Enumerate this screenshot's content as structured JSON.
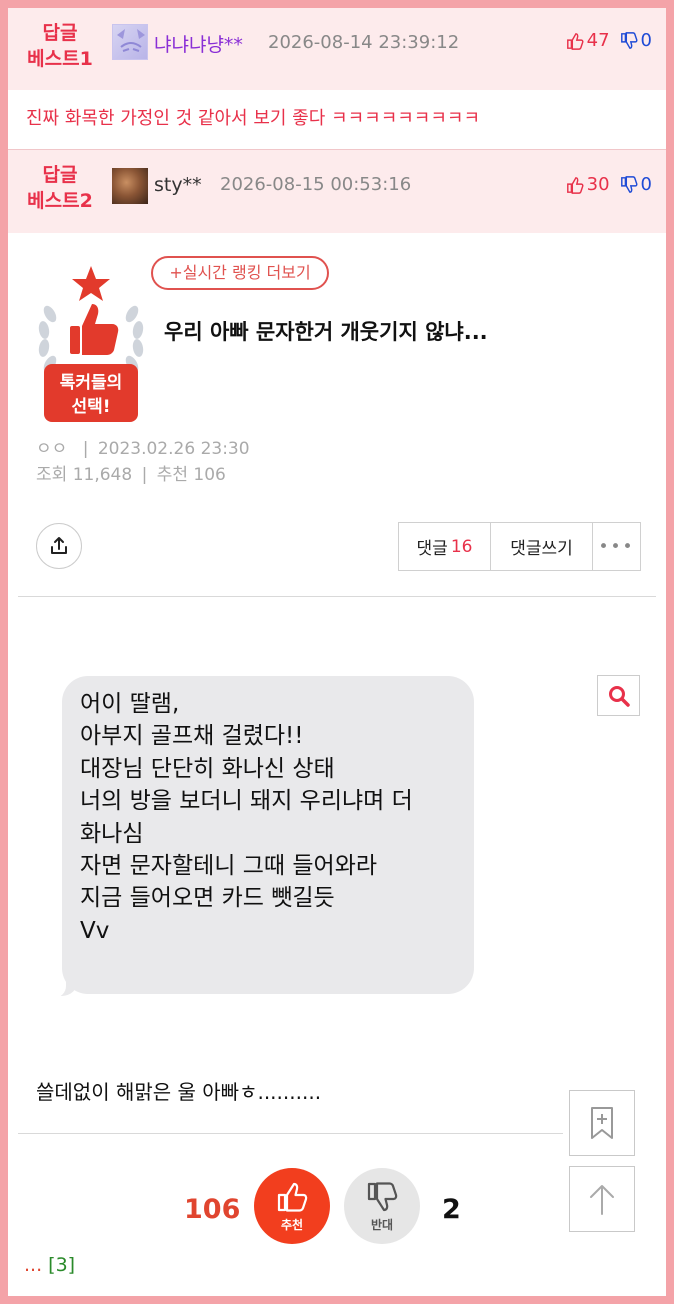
{
  "best_replies": [
    {
      "label_line1": "답글",
      "label_line2": "베스트1",
      "nickname": "냐냐냐냥**",
      "date": "2026-08-14 23:39:12",
      "up": "47",
      "down": "0",
      "text": "진짜 화목한 가정인 것 같아서 보기 좋다 ㅋㅋㅋㅋㅋㅋㅋㅋㅋ"
    },
    {
      "label_line1": "답글",
      "label_line2": "베스트2",
      "nickname": "sty**",
      "date": "2026-08-15 00:53:16",
      "up": "30",
      "down": "0"
    }
  ],
  "ranking": {
    "more_label": "+실시간 랭킹 더보기",
    "badge_line1": "톡커들의",
    "badge_line2": "선택!"
  },
  "post": {
    "title": "우리 아빠 문자한거 개웃기지 않냐...",
    "author": "ㅇㅇ",
    "date": "2023.02.26 23:30",
    "views_label": "조회",
    "views": "11,648",
    "recommend_label": "추천",
    "recommend": "106"
  },
  "actions": {
    "comments_label": "댓글",
    "comments_count": "16",
    "write_label": "댓글쓰기",
    "more_label": "•••"
  },
  "message_lines": [
    "어이 딸램,",
    "아부지 골프채 걸렸다!!",
    "대장님 단단히 화나신 상태",
    "너의 방을 보더니 돼지 우리냐며 더",
    "화나심",
    "자면 문자할테니 그때 들어와라",
    "지금 들어오면 카드 뺏길듯",
    "Vv"
  ],
  "body_text": "쓸데없이 해맑은 울 아빠ㅎ..........",
  "vote": {
    "recommend_count": "106",
    "recommend_label": "추천",
    "oppose_label": "반대",
    "oppose_count": "2"
  },
  "footer": {
    "ellipsis": "...",
    "count": "[3]"
  },
  "colors": {
    "accent_red": "#e8314a",
    "frame_pink": "#f4a3a8",
    "best_bg": "#fdebec",
    "down_blue": "#1f4bd6"
  }
}
